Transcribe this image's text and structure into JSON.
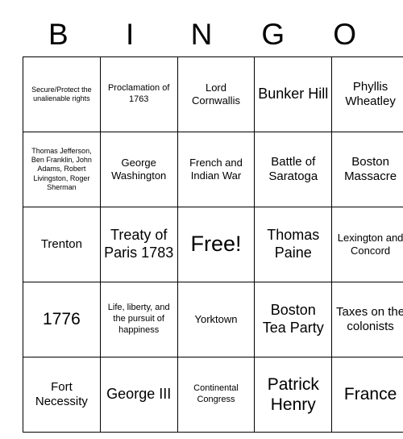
{
  "card": {
    "header_letters": [
      "B",
      "I",
      "N",
      "G",
      "O"
    ],
    "rows": [
      [
        {
          "text": "Secure/Protect the unalienable rights",
          "size": "fs-xs"
        },
        {
          "text": "Proclamation of 1763",
          "size": "fs-s"
        },
        {
          "text": "Lord Cornwallis",
          "size": "fs-m"
        },
        {
          "text": "Bunker Hill",
          "size": "fs-xl"
        },
        {
          "text": "Phyllis Wheatley",
          "size": "fs-l"
        }
      ],
      [
        {
          "text": "Thomas Jefferson, Ben Franklin, John Adams, Robert Livingston, Roger Sherman",
          "size": "fs-xs"
        },
        {
          "text": "George Washington",
          "size": "fs-m"
        },
        {
          "text": "French and Indian War",
          "size": "fs-m"
        },
        {
          "text": "Battle of Saratoga",
          "size": "fs-l"
        },
        {
          "text": "Boston Massacre",
          "size": "fs-l"
        }
      ],
      [
        {
          "text": "Trenton",
          "size": "fs-l"
        },
        {
          "text": "Treaty of Paris 1783",
          "size": "fs-xl"
        },
        {
          "text": "Free!",
          "size": "fs-free"
        },
        {
          "text": "Thomas Paine",
          "size": "fs-xl"
        },
        {
          "text": "Lexington and Concord",
          "size": "fs-m"
        }
      ],
      [
        {
          "text": "1776",
          "size": "fs-xxl"
        },
        {
          "text": "Life, liberty, and the pursuit of happiness",
          "size": "fs-s"
        },
        {
          "text": "Yorktown",
          "size": "fs-m"
        },
        {
          "text": "Boston Tea Party",
          "size": "fs-xl"
        },
        {
          "text": "Taxes on the colonists",
          "size": "fs-l"
        }
      ],
      [
        {
          "text": "Fort Necessity",
          "size": "fs-l"
        },
        {
          "text": "George III",
          "size": "fs-xl"
        },
        {
          "text": "Continental Congress",
          "size": "fs-s"
        },
        {
          "text": "Patrick Henry",
          "size": "fs-xxl"
        },
        {
          "text": "France",
          "size": "fs-xxl"
        }
      ]
    ]
  },
  "colors": {
    "text": "#000000",
    "border": "#000000",
    "background": "#ffffff"
  }
}
